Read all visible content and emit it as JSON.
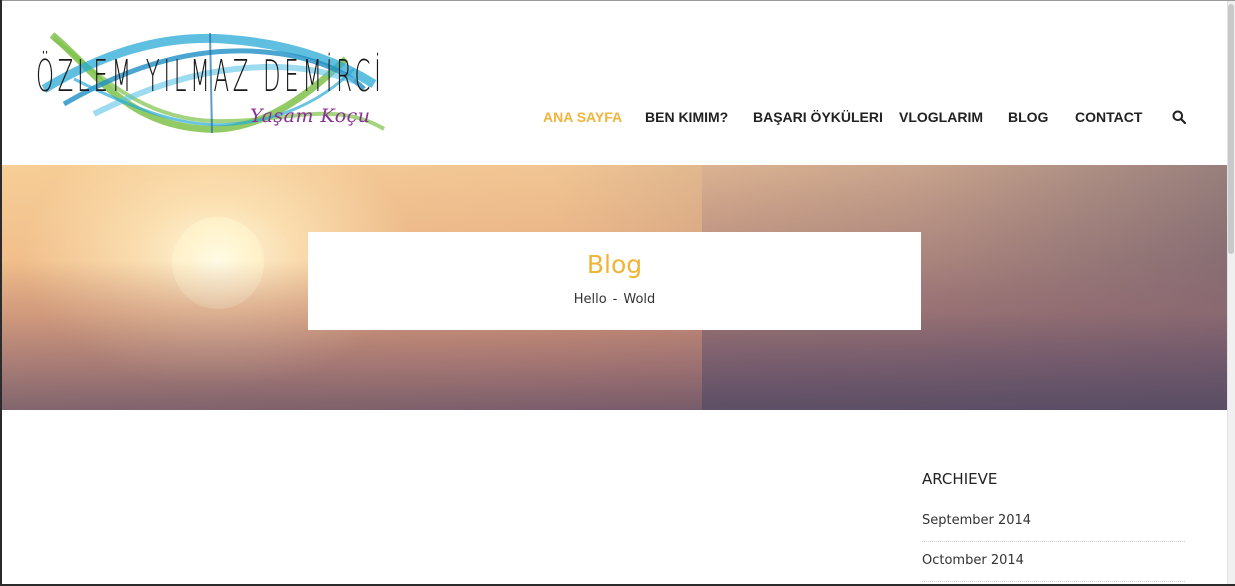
{
  "header": {
    "logo": {
      "name": "ÖZLEM YILMAZ DEMİRCİ",
      "tagline": "Yaşam Koçu",
      "colors": {
        "swirl_blue": "#2aa9d6",
        "swirl_green": "#7fc24a",
        "tagline_purple": "#8b2f95"
      }
    },
    "nav": {
      "items": [
        {
          "label": "ANA SAYFA",
          "active": true
        },
        {
          "label": "BEN KIMIM?",
          "active": false
        },
        {
          "label": "BAŞARI ÖYKÜLERI",
          "active": false
        },
        {
          "label": "VLOGLARIM",
          "active": false
        },
        {
          "label": "BLOG",
          "active": false
        },
        {
          "label": "CONTACT",
          "active": false
        }
      ],
      "search_icon": "search-icon",
      "active_color": "#f0b43a"
    }
  },
  "banner": {
    "title": "Blog",
    "breadcrumb": {
      "home": "Hello",
      "separator": "-",
      "current": "Wold"
    }
  },
  "sidebar": {
    "archive": {
      "title": "ARCHIEVE",
      "items": [
        "September 2014",
        "Octomber 2014"
      ]
    }
  }
}
